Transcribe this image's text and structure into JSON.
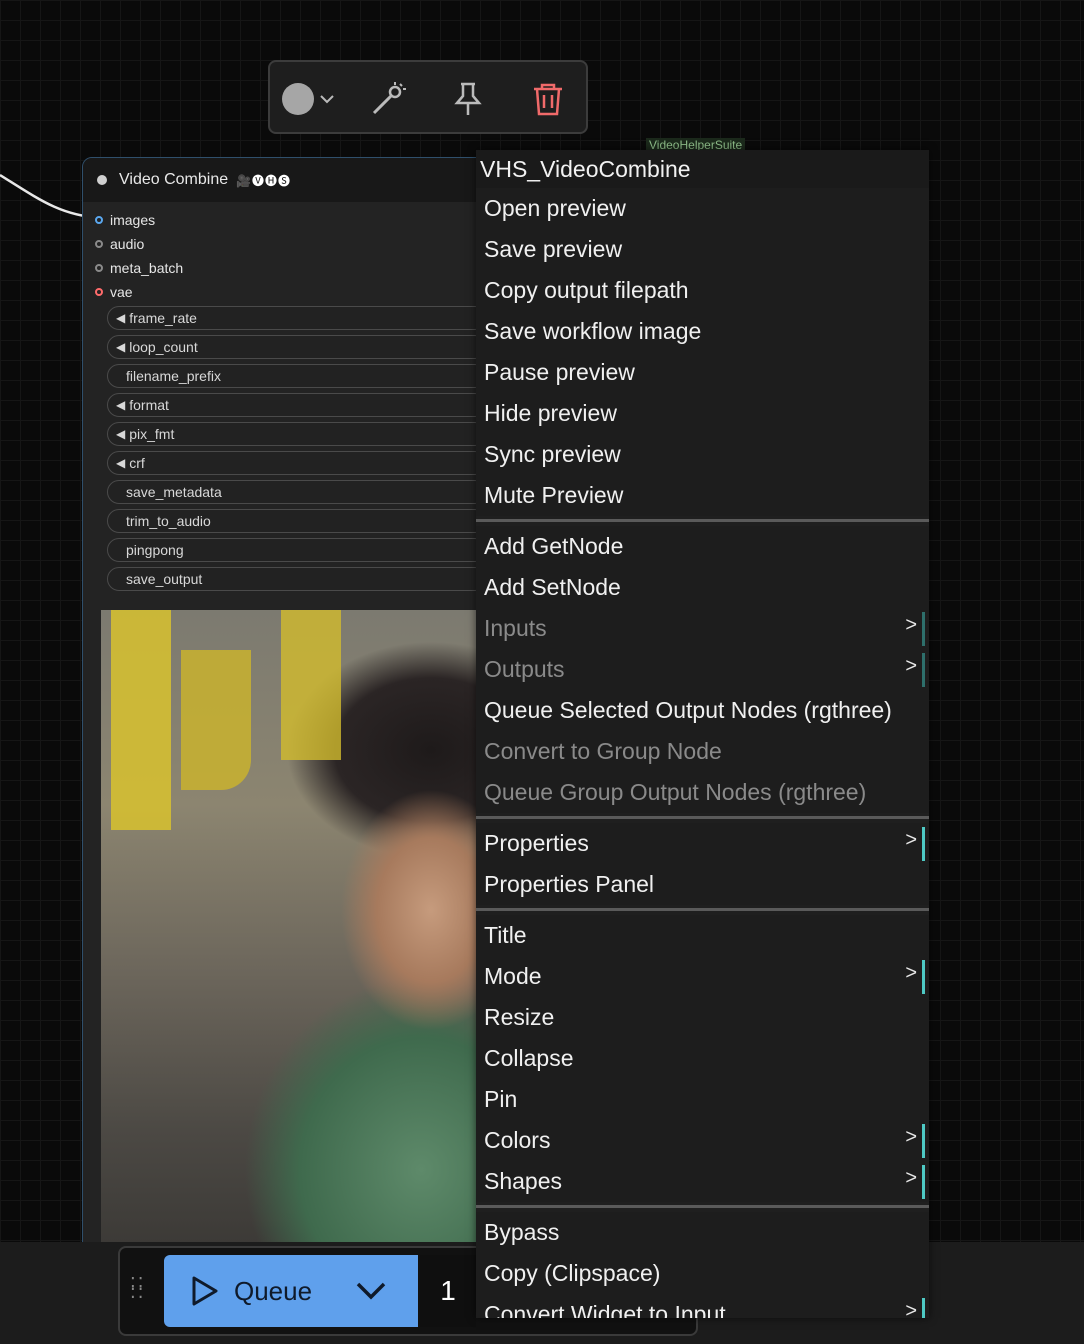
{
  "toolbar": {
    "color_icon": "color-circle",
    "bypass_icon": "wand-icon",
    "pin_icon": "pin-icon",
    "delete_icon": "trash-icon"
  },
  "node": {
    "title": "Video Combine",
    "badge": "🎥🅥🅗🅢",
    "inputs": [
      {
        "label": "images",
        "color": "#5aa7ee"
      },
      {
        "label": "audio",
        "color": "#8a8a8a"
      },
      {
        "label": "meta_batch",
        "color": "#8a8a8a"
      },
      {
        "label": "vae",
        "color": "#ff6b6b"
      }
    ],
    "widgets": [
      {
        "label": "frame_rate",
        "arrow": true
      },
      {
        "label": "loop_count",
        "arrow": true
      },
      {
        "label": "filename_prefix",
        "arrow": false
      },
      {
        "label": "format",
        "arrow": true
      },
      {
        "label": "pix_fmt",
        "arrow": true
      },
      {
        "label": "crf",
        "arrow": true
      },
      {
        "label": "save_metadata",
        "arrow": false
      },
      {
        "label": "trim_to_audio",
        "arrow": false
      },
      {
        "label": "pingpong",
        "arrow": false
      },
      {
        "label": "save_output",
        "arrow": false
      }
    ]
  },
  "menu": {
    "title": "VHS_VideoCombine",
    "groups": [
      [
        {
          "label": "Open preview"
        },
        {
          "label": "Save preview"
        },
        {
          "label": "Copy output filepath"
        },
        {
          "label": "Save workflow image"
        },
        {
          "label": "Pause preview"
        },
        {
          "label": "Hide preview"
        },
        {
          "label": "Sync preview"
        },
        {
          "label": "Mute Preview"
        }
      ],
      [
        {
          "label": "Add GetNode"
        },
        {
          "label": "Add SetNode"
        },
        {
          "label": "Inputs",
          "disabled": true,
          "submenu": true
        },
        {
          "label": "Outputs",
          "disabled": true,
          "submenu": true
        },
        {
          "label": "Queue Selected Output Nodes (rgthree)"
        },
        {
          "label": "Convert to Group Node",
          "disabled": true
        },
        {
          "label": "Queue Group Output Nodes (rgthree)",
          "disabled": true
        }
      ],
      [
        {
          "label": "Properties",
          "submenu": true
        },
        {
          "label": "Properties Panel"
        }
      ],
      [
        {
          "label": "Title"
        },
        {
          "label": "Mode",
          "submenu": true
        },
        {
          "label": "Resize"
        },
        {
          "label": "Collapse"
        },
        {
          "label": "Pin"
        },
        {
          "label": "Colors",
          "submenu": true
        },
        {
          "label": "Shapes",
          "submenu": true
        }
      ],
      [
        {
          "label": "Bypass"
        },
        {
          "label": "Copy (Clipspace)"
        },
        {
          "label": "Convert Widget to Input",
          "submenu": true
        }
      ]
    ],
    "submenu_glyph": ">"
  },
  "queue": {
    "label": "Queue",
    "count": "1"
  },
  "group_label": "VideoHelperSuite"
}
